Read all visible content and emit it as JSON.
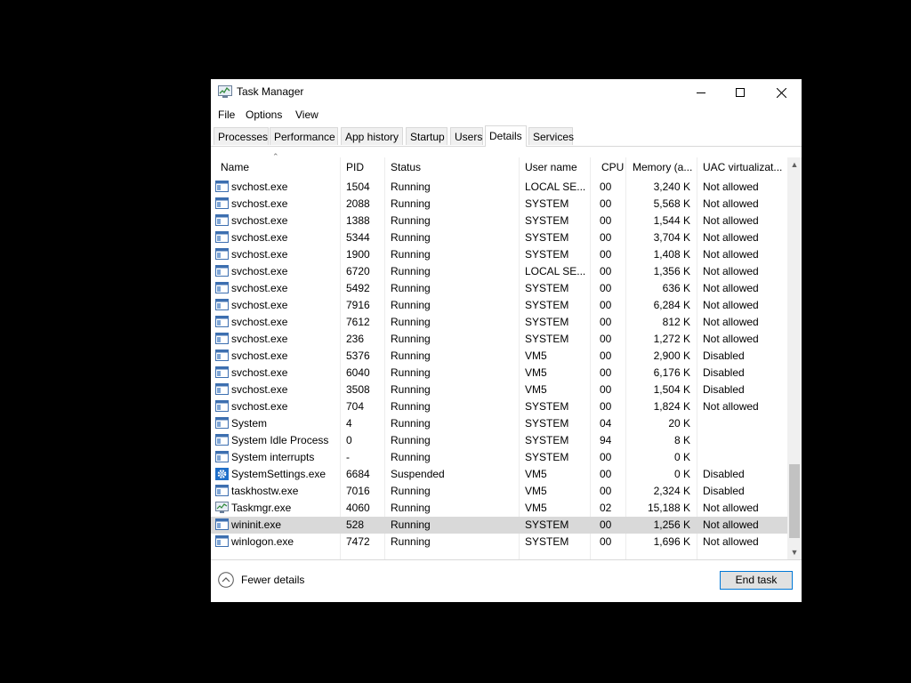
{
  "window": {
    "title": "Task Manager"
  },
  "icons": {
    "app": "task-manager-icon",
    "minimize": "minimize-icon",
    "maximize": "maximize-icon",
    "close": "close-icon",
    "process": "process-window-icon",
    "settings": "gear-icon",
    "taskmgr": "task-manager-icon",
    "fewer": "chevron-up-icon"
  },
  "menu": [
    "File",
    "Options",
    "View"
  ],
  "tabs": [
    "Processes",
    "Performance",
    "App history",
    "Startup",
    "Users",
    "Details",
    "Services"
  ],
  "active_tab": "Details",
  "columns": [
    "Name",
    "PID",
    "Status",
    "User name",
    "CPU",
    "Memory (a...",
    "UAC virtualizat..."
  ],
  "rows": [
    {
      "name": "svchost.exe",
      "pid": "1504",
      "status": "Running",
      "user": "LOCAL SE...",
      "cpu": "00",
      "memory": "3,240 K",
      "uac": "Not allowed",
      "icon": "process"
    },
    {
      "name": "svchost.exe",
      "pid": "2088",
      "status": "Running",
      "user": "SYSTEM",
      "cpu": "00",
      "memory": "5,568 K",
      "uac": "Not allowed",
      "icon": "process"
    },
    {
      "name": "svchost.exe",
      "pid": "1388",
      "status": "Running",
      "user": "SYSTEM",
      "cpu": "00",
      "memory": "1,544 K",
      "uac": "Not allowed",
      "icon": "process"
    },
    {
      "name": "svchost.exe",
      "pid": "5344",
      "status": "Running",
      "user": "SYSTEM",
      "cpu": "00",
      "memory": "3,704 K",
      "uac": "Not allowed",
      "icon": "process"
    },
    {
      "name": "svchost.exe",
      "pid": "1900",
      "status": "Running",
      "user": "SYSTEM",
      "cpu": "00",
      "memory": "1,408 K",
      "uac": "Not allowed",
      "icon": "process"
    },
    {
      "name": "svchost.exe",
      "pid": "6720",
      "status": "Running",
      "user": "LOCAL SE...",
      "cpu": "00",
      "memory": "1,356 K",
      "uac": "Not allowed",
      "icon": "process"
    },
    {
      "name": "svchost.exe",
      "pid": "5492",
      "status": "Running",
      "user": "SYSTEM",
      "cpu": "00",
      "memory": "636 K",
      "uac": "Not allowed",
      "icon": "process"
    },
    {
      "name": "svchost.exe",
      "pid": "7916",
      "status": "Running",
      "user": "SYSTEM",
      "cpu": "00",
      "memory": "6,284 K",
      "uac": "Not allowed",
      "icon": "process"
    },
    {
      "name": "svchost.exe",
      "pid": "7612",
      "status": "Running",
      "user": "SYSTEM",
      "cpu": "00",
      "memory": "812 K",
      "uac": "Not allowed",
      "icon": "process"
    },
    {
      "name": "svchost.exe",
      "pid": "236",
      "status": "Running",
      "user": "SYSTEM",
      "cpu": "00",
      "memory": "1,272 K",
      "uac": "Not allowed",
      "icon": "process"
    },
    {
      "name": "svchost.exe",
      "pid": "5376",
      "status": "Running",
      "user": "VM5",
      "cpu": "00",
      "memory": "2,900 K",
      "uac": "Disabled",
      "icon": "process"
    },
    {
      "name": "svchost.exe",
      "pid": "6040",
      "status": "Running",
      "user": "VM5",
      "cpu": "00",
      "memory": "6,176 K",
      "uac": "Disabled",
      "icon": "process"
    },
    {
      "name": "svchost.exe",
      "pid": "3508",
      "status": "Running",
      "user": "VM5",
      "cpu": "00",
      "memory": "1,504 K",
      "uac": "Disabled",
      "icon": "process"
    },
    {
      "name": "svchost.exe",
      "pid": "704",
      "status": "Running",
      "user": "SYSTEM",
      "cpu": "00",
      "memory": "1,824 K",
      "uac": "Not allowed",
      "icon": "process"
    },
    {
      "name": "System",
      "pid": "4",
      "status": "Running",
      "user": "SYSTEM",
      "cpu": "04",
      "memory": "20 K",
      "uac": "",
      "icon": "process"
    },
    {
      "name": "System Idle Process",
      "pid": "0",
      "status": "Running",
      "user": "SYSTEM",
      "cpu": "94",
      "memory": "8 K",
      "uac": "",
      "icon": "process"
    },
    {
      "name": "System interrupts",
      "pid": "-",
      "status": "Running",
      "user": "SYSTEM",
      "cpu": "00",
      "memory": "0 K",
      "uac": "",
      "icon": "process"
    },
    {
      "name": "SystemSettings.exe",
      "pid": "6684",
      "status": "Suspended",
      "user": "VM5",
      "cpu": "00",
      "memory": "0 K",
      "uac": "Disabled",
      "icon": "settings"
    },
    {
      "name": "taskhostw.exe",
      "pid": "7016",
      "status": "Running",
      "user": "VM5",
      "cpu": "00",
      "memory": "2,324 K",
      "uac": "Disabled",
      "icon": "process"
    },
    {
      "name": "Taskmgr.exe",
      "pid": "4060",
      "status": "Running",
      "user": "VM5",
      "cpu": "02",
      "memory": "15,188 K",
      "uac": "Not allowed",
      "icon": "taskmgr"
    },
    {
      "name": "wininit.exe",
      "pid": "528",
      "status": "Running",
      "user": "SYSTEM",
      "cpu": "00",
      "memory": "1,256 K",
      "uac": "Not allowed",
      "icon": "process"
    },
    {
      "name": "winlogon.exe",
      "pid": "7472",
      "status": "Running",
      "user": "SYSTEM",
      "cpu": "00",
      "memory": "1,696 K",
      "uac": "Not allowed",
      "icon": "process"
    }
  ],
  "selected_row": "wininit.exe",
  "footer": {
    "fewer_details": "Fewer details",
    "end_task": "End task"
  },
  "colors": {
    "selected": "#d9d9d9",
    "accent_border": "#0078d7"
  }
}
